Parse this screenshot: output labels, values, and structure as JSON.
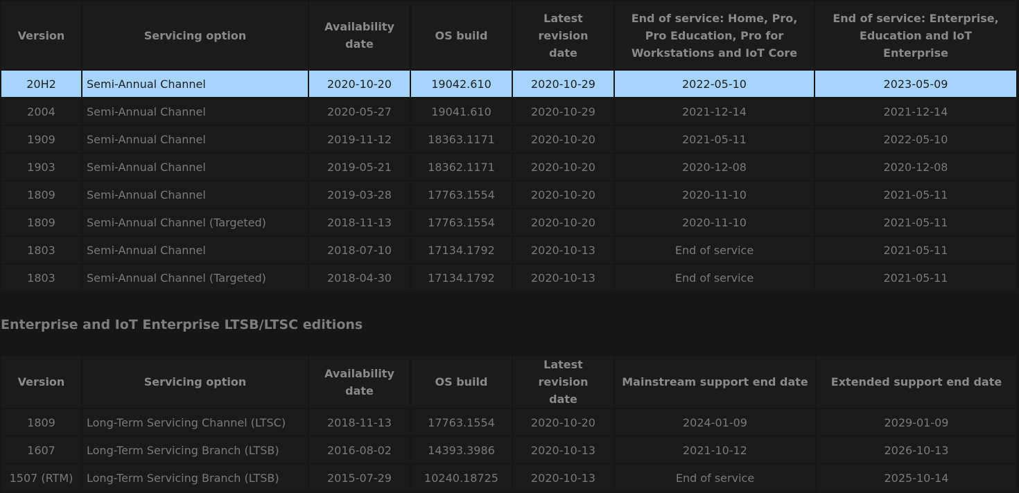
{
  "table1": {
    "headers": [
      "Version",
      "Servicing option",
      "Availability date",
      "OS build",
      "Latest revision date",
      "End of service: Home, Pro, Pro Education, Pro for Workstations and IoT Core",
      "End of service: Enterprise, Education and IoT Enterprise"
    ],
    "rows": [
      [
        "20H2",
        "Semi-Annual Channel",
        "2020-10-20",
        "19042.610",
        "2020-10-29",
        "2022-05-10",
        "2023-05-09"
      ],
      [
        "2004",
        "Semi-Annual Channel",
        "2020-05-27",
        "19041.610",
        "2020-10-29",
        "2021-12-14",
        "2021-12-14"
      ],
      [
        "1909",
        "Semi-Annual Channel",
        "2019-11-12",
        "18363.1171",
        "2020-10-20",
        "2021-05-11",
        "2022-05-10"
      ],
      [
        "1903",
        "Semi-Annual Channel",
        "2019-05-21",
        "18362.1171",
        "2020-10-20",
        "2020-12-08",
        "2020-12-08"
      ],
      [
        "1809",
        "Semi-Annual Channel",
        "2019-03-28",
        "17763.1554",
        "2020-10-20",
        "2020-11-10",
        "2021-05-11"
      ],
      [
        "1809",
        "Semi-Annual Channel (Targeted)",
        "2018-11-13",
        "17763.1554",
        "2020-10-20",
        "2020-11-10",
        "2021-05-11"
      ],
      [
        "1803",
        "Semi-Annual Channel",
        "2018-07-10",
        "17134.1792",
        "2020-10-13",
        "End of service",
        "2021-05-11"
      ],
      [
        "1803",
        "Semi-Annual Channel (Targeted)",
        "2018-04-30",
        "17134.1792",
        "2020-10-13",
        "End of service",
        "2021-05-11"
      ]
    ]
  },
  "section2": {
    "title": "Enterprise and IoT Enterprise LTSB/LTSC editions"
  },
  "table2": {
    "headers": [
      "Version",
      "Servicing option",
      "Availability date",
      "OS build",
      "Latest revision date",
      "Mainstream support end date",
      "Extended support end date"
    ],
    "rows": [
      [
        "1809",
        "Long-Term Servicing Channel (LTSC)",
        "2018-11-13",
        "17763.1554",
        "2020-10-20",
        "2024-01-09",
        "2029-01-09"
      ],
      [
        "1607",
        "Long-Term Servicing Branch (LTSB)",
        "2016-08-02",
        "14393.3986",
        "2020-10-13",
        "2021-10-12",
        "2026-10-13"
      ],
      [
        "1507 (RTM)",
        "Long-Term Servicing Branch (LTSB)",
        "2015-07-29",
        "10240.18725",
        "2020-10-13",
        "End of service",
        "2025-10-14"
      ]
    ]
  },
  "colors": {
    "background": "#161616",
    "cell": "#1a1a1a",
    "selected_row": "#a6d4fa",
    "text": "#7a7a7a"
  }
}
